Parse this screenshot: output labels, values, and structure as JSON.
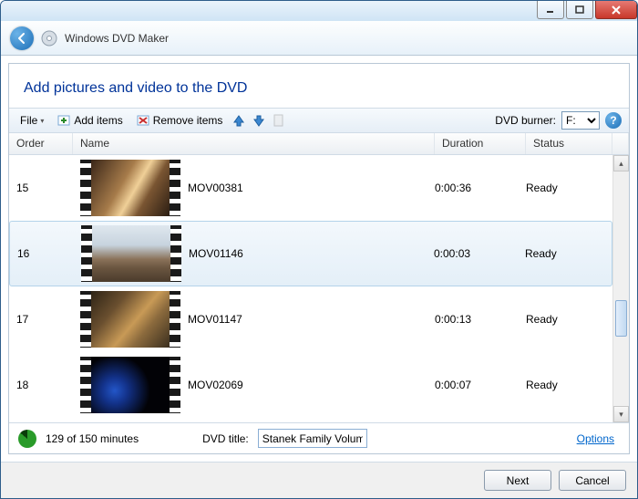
{
  "app": {
    "title": "Windows DVD Maker"
  },
  "heading": "Add pictures and video to the DVD",
  "toolbar": {
    "file": "File",
    "add": "Add items",
    "remove": "Remove items",
    "burner_label": "DVD burner:",
    "burner_options": [
      "F:"
    ],
    "burner_selected": "F:"
  },
  "columns": {
    "order": "Order",
    "name": "Name",
    "duration": "Duration",
    "status": "Status"
  },
  "items": [
    {
      "order": "15",
      "name": "MOV00381",
      "duration": "0:00:36",
      "status": "Ready",
      "thumb": "t1",
      "selected": false
    },
    {
      "order": "16",
      "name": "MOV01146",
      "duration": "0:00:03",
      "status": "Ready",
      "thumb": "t2",
      "selected": true
    },
    {
      "order": "17",
      "name": "MOV01147",
      "duration": "0:00:13",
      "status": "Ready",
      "thumb": "t3",
      "selected": false
    },
    {
      "order": "18",
      "name": "MOV02069",
      "duration": "0:00:07",
      "status": "Ready",
      "thumb": "t4",
      "selected": false
    }
  ],
  "footer": {
    "disc_info": "129 of 150 minutes",
    "title_label": "DVD title:",
    "title_value": "Stanek Family Volum",
    "options": "Options"
  },
  "buttons": {
    "next": "Next",
    "cancel": "Cancel"
  }
}
